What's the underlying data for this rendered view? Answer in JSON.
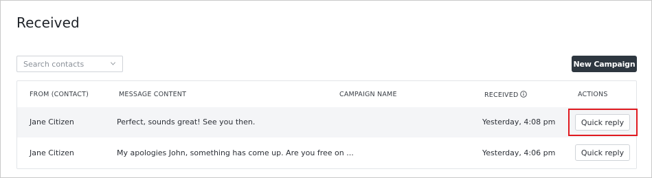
{
  "page": {
    "title": "Received"
  },
  "search": {
    "placeholder": "Search contacts"
  },
  "toolbar": {
    "new_campaign_label": "New Campaign"
  },
  "table": {
    "columns": [
      "FROM (CONTACT)",
      "MESSAGE CONTENT",
      "CAMPAIGN NAME",
      "RECEIVED",
      "ACTIONS"
    ],
    "rows": [
      {
        "from": "Jane Citizen",
        "message": "Perfect, sounds great! See you then.",
        "campaign": "",
        "received": "Yesterday, 4:08 pm",
        "action": "Quick reply"
      },
      {
        "from": "Jane Citizen",
        "message": "My apologies John, something has come up. Are you free on ...",
        "campaign": "",
        "received": "Yesterday, 4:06 pm",
        "action": "Quick reply"
      }
    ]
  },
  "colors": {
    "primary_button": "#2e3740",
    "highlight": "#e0191f",
    "row_alt": "#f4f5f7"
  },
  "icons": {
    "dropdown": "chevron-down-icon",
    "received_info": "info-icon"
  }
}
